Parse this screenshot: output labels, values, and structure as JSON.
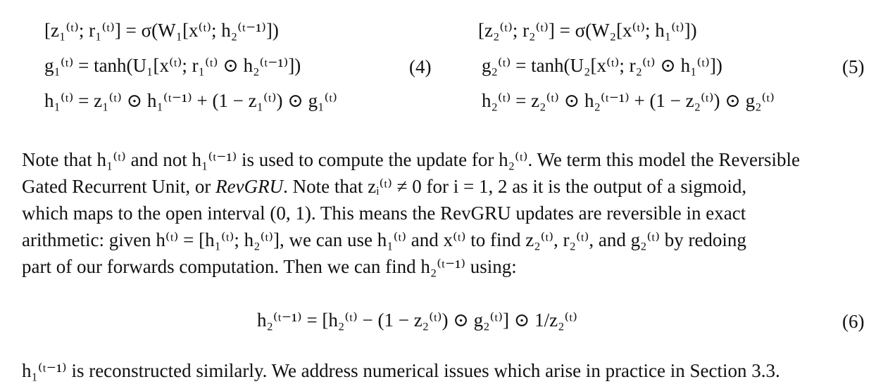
{
  "equations_left": {
    "line1": "[z₁⁽ᵗ⁾; r₁⁽ᵗ⁾] = σ(W₁[x⁽ᵗ⁾; h₂⁽ᵗ⁻¹⁾])",
    "line2": "g₁⁽ᵗ⁾ = tanh(U₁[x⁽ᵗ⁾; r₁⁽ᵗ⁾ ⊙ h₂⁽ᵗ⁻¹⁾])",
    "line3": "h₁⁽ᵗ⁾ = z₁⁽ᵗ⁾ ⊙ h₁⁽ᵗ⁻¹⁾ + (1 − z₁⁽ᵗ⁾) ⊙ g₁⁽ᵗ⁾",
    "number": "(4)"
  },
  "equations_right": {
    "line1": "[z₂⁽ᵗ⁾; r₂⁽ᵗ⁾] = σ(W₂[x⁽ᵗ⁾; h₁⁽ᵗ⁾])",
    "line2": "g₂⁽ᵗ⁾ = tanh(U₂[x⁽ᵗ⁾; r₂⁽ᵗ⁾ ⊙ h₁⁽ᵗ⁾])",
    "line3": "h₂⁽ᵗ⁾ = z₂⁽ᵗ⁾ ⊙ h₂⁽ᵗ⁻¹⁾ + (1 − z₂⁽ᵗ⁾) ⊙ g₂⁽ᵗ⁾",
    "number": "(5)"
  },
  "paragraph1": {
    "line1": "Note that h₁⁽ᵗ⁾ and not h₁⁽ᵗ⁻¹⁾ is used to compute the update for h₂⁽ᵗ⁾. We term this model the Reversible",
    "line2_a": "Gated Recurrent Unit, or ",
    "line2_em": "RevGRU",
    "line2_b": ". Note that zᵢ⁽ᵗ⁾ ≠ 0 for i = 1, 2 as it is the output of a sigmoid,",
    "line3": "which maps to the open interval (0, 1).  This means the RevGRU updates are reversible in exact",
    "line4": "arithmetic: given h⁽ᵗ⁾ = [h₁⁽ᵗ⁾; h₂⁽ᵗ⁾], we can use h₁⁽ᵗ⁾ and x⁽ᵗ⁾ to find z₂⁽ᵗ⁾, r₂⁽ᵗ⁾, and g₂⁽ᵗ⁾ by redoing",
    "line5": "part of our forwards computation. Then we can find h₂⁽ᵗ⁻¹⁾ using:"
  },
  "equation6": {
    "text": "h₂⁽ᵗ⁻¹⁾ = [h₂⁽ᵗ⁾ − (1 − z₂⁽ᵗ⁾) ⊙ g₂⁽ᵗ⁾] ⊙ 1/z₂⁽ᵗ⁾",
    "number": "(6)"
  },
  "paragraph2": {
    "line1": "h₁⁽ᵗ⁻¹⁾ is reconstructed similarly. We address numerical issues which arise in practice in Section 3.3."
  }
}
